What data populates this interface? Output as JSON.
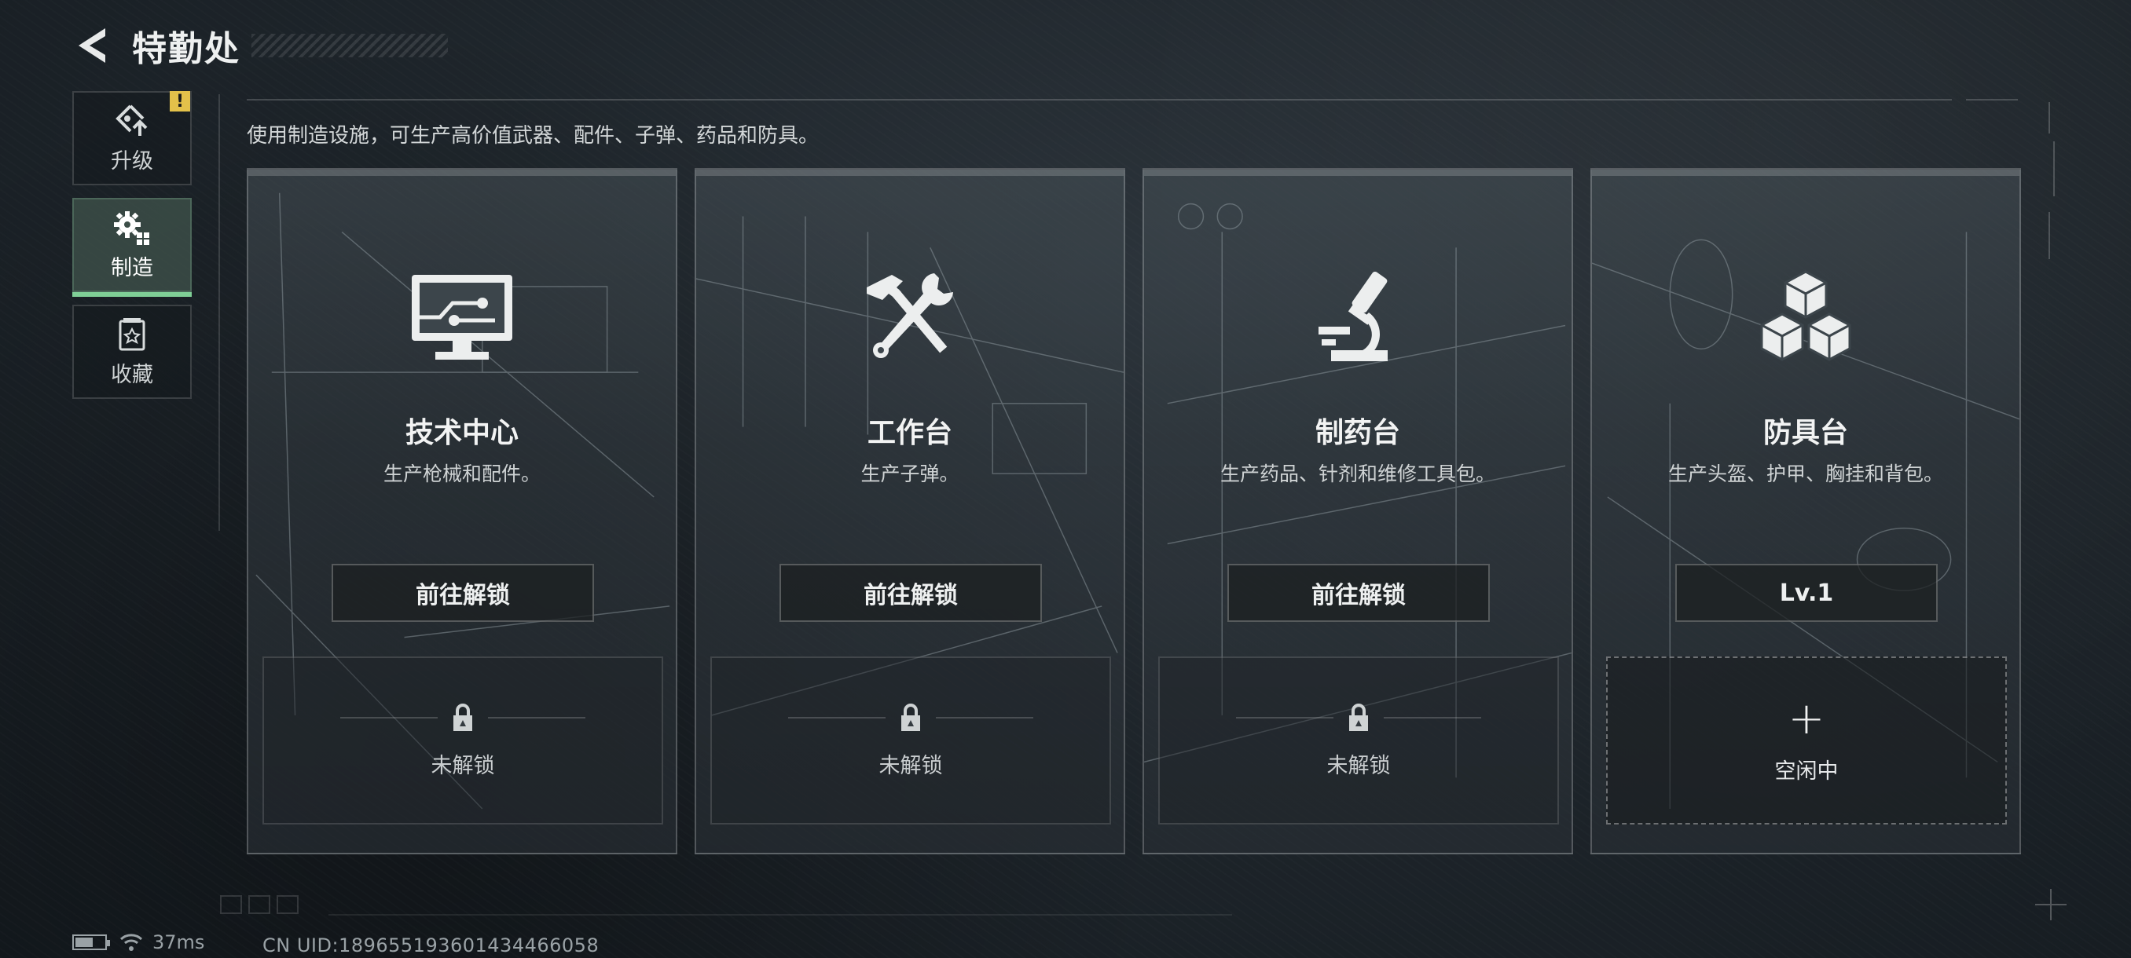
{
  "header": {
    "title": "特勤处"
  },
  "sidebar": {
    "items": [
      {
        "label": "升级",
        "icon": "upgrade-icon",
        "badge": "!"
      },
      {
        "label": "制造",
        "icon": "gear-icon",
        "active": true
      },
      {
        "label": "收藏",
        "icon": "collection-icon"
      }
    ]
  },
  "main": {
    "description": "使用制造设施，可生产高价值武器、配件、子弹、药品和防具。",
    "cards": [
      {
        "name": "技术中心",
        "subtitle": "生产枪械和配件。",
        "button": "前往解锁",
        "slot_status": "未解锁",
        "icon": "monitor-icon"
      },
      {
        "name": "工作台",
        "subtitle": "生产子弹。",
        "button": "前往解锁",
        "slot_status": "未解锁",
        "icon": "hammer-wrench-icon"
      },
      {
        "name": "制药台",
        "subtitle": "生产药品、针剂和维修工具包。",
        "button": "前往解锁",
        "slot_status": "未解锁",
        "icon": "microscope-icon"
      },
      {
        "name": "防具台",
        "subtitle": "生产头盔、护甲、胸挂和背包。",
        "button": "Lv.1",
        "slot_status": "空闲中",
        "slot_symbol": "+",
        "icon": "cubes-icon"
      }
    ]
  },
  "status": {
    "ping": "37ms",
    "uid": "CN UID:1896551936014344660​58"
  },
  "colors": {
    "accent": "#7fcf96",
    "warning": "#e3c14a"
  }
}
